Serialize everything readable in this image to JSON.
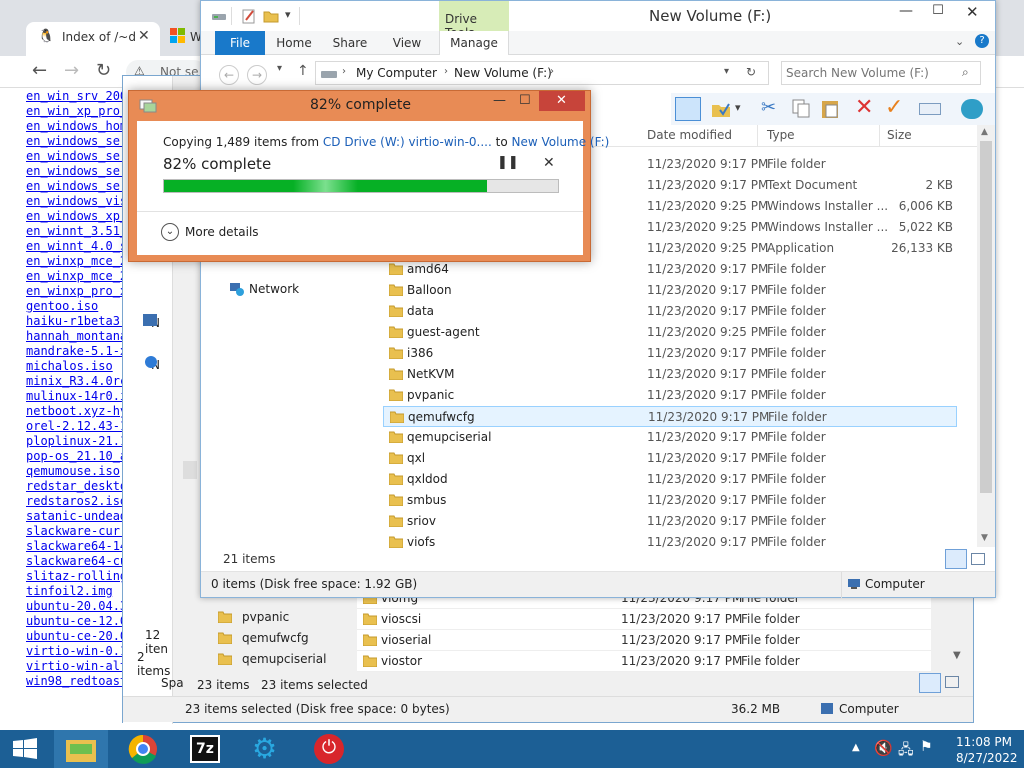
{
  "browser": {
    "tab1_title": "Index of /~d",
    "tab2_title": "W",
    "address_text": "Not se",
    "files": [
      "en_win_srv_200",
      "en_win_xp_pro_",
      "en_windows_hom",
      "en_windows_ser",
      "en_windows_ser",
      "en_windows_ser",
      "en_windows_ser",
      "en_windows_vis",
      "en_windows_xp_",
      "en_winnt_3.51_",
      "en_winnt_4.0_s",
      "en_winxp_mce_2",
      "en_winxp_mce_2",
      "en_winxp_pro_x",
      "gentoo.iso",
      "haiku-r1beta3-",
      "hannah_montana",
      "mandrake-5.1-x",
      "michalos.iso",
      "minix_R3.4.0rc",
      "mulinux-14r0.i",
      "netboot.xyz-hy",
      "orel-2.12.43-1",
      "ploplinux-21.1",
      "pop-os_21.10_a",
      "qemumouse.iso",
      "redstar_deskto",
      "redstaros2.iso",
      "satanic-undead",
      "slackware-curr",
      "slackware64-14",
      "slackware64-cu",
      "slitaz-rolling",
      "tinfoil2.img",
      "ubuntu-20.04.3",
      "ubuntu-ce-12.0",
      "ubuntu-ce-20.0",
      "virtio-win-0.1",
      "virtio-win-alt",
      "win98_redtoast_al"
    ]
  },
  "explorer_back": {
    "nav_items": [
      "pvpanic",
      "qemufwcfg",
      "qemupciserial"
    ],
    "left_fragments": {
      "items_12": "12 iten",
      "items_2": "2 items",
      "spa": "Spa",
      "n1": "N",
      "n2": "N"
    },
    "rows": [
      {
        "name": "viomg",
        "date": "11/23/2020 9:17 PM",
        "type": "File folder"
      },
      {
        "name": "vioscsi",
        "date": "11/23/2020 9:17 PM",
        "type": "File folder"
      },
      {
        "name": "vioserial",
        "date": "11/23/2020 9:17 PM",
        "type": "File folder"
      },
      {
        "name": "viostor",
        "date": "11/23/2020 9:17 PM",
        "type": "File folder"
      }
    ],
    "status": {
      "items": "23 items",
      "selected": "23 items selected"
    },
    "bottom": {
      "left": "23 items selected (Disk free space: 0 bytes)",
      "size": "36.2 MB",
      "location": "Computer"
    }
  },
  "explorer": {
    "title": "New Volume (F:)",
    "context_tab": "Drive Tools",
    "tabs": {
      "file": "File",
      "home": "Home",
      "share": "Share",
      "view": "View",
      "manage": "Manage"
    },
    "breadcrumb": {
      "root": "My Computer",
      "current": "New Volume (F:)"
    },
    "search_placeholder": "Search New Volume (F:)",
    "columns": {
      "date": "Date modified",
      "type": "Type",
      "size": "Size"
    },
    "nav_network": "Network",
    "rows": [
      {
        "name": "",
        "date": "11/23/2020 9:17 PM",
        "type": "File folder",
        "size": ""
      },
      {
        "name": "",
        "date": "11/23/2020 9:17 PM",
        "type": "Text Document",
        "size": "2 KB"
      },
      {
        "name": "",
        "date": "11/23/2020 9:25 PM",
        "type": "Windows Installer ...",
        "size": "6,006 KB"
      },
      {
        "name": "",
        "date": "11/23/2020 9:25 PM",
        "type": "Windows Installer ...",
        "size": "5,022 KB"
      },
      {
        "name": "",
        "date": "11/23/2020 9:25 PM",
        "type": "Application",
        "size": "26,133 KB"
      },
      {
        "name": "amd64",
        "date": "11/23/2020 9:17 PM",
        "type": "File folder",
        "size": ""
      },
      {
        "name": "Balloon",
        "date": "11/23/2020 9:17 PM",
        "type": "File folder",
        "size": ""
      },
      {
        "name": "data",
        "date": "11/23/2020 9:17 PM",
        "type": "File folder",
        "size": ""
      },
      {
        "name": "guest-agent",
        "date": "11/23/2020 9:25 PM",
        "type": "File folder",
        "size": ""
      },
      {
        "name": "i386",
        "date": "11/23/2020 9:17 PM",
        "type": "File folder",
        "size": ""
      },
      {
        "name": "NetKVM",
        "date": "11/23/2020 9:17 PM",
        "type": "File folder",
        "size": ""
      },
      {
        "name": "pvpanic",
        "date": "11/23/2020 9:17 PM",
        "type": "File folder",
        "size": ""
      },
      {
        "name": "qemufwcfg",
        "date": "11/23/2020 9:17 PM",
        "type": "File folder",
        "size": ""
      },
      {
        "name": "qemupciserial",
        "date": "11/23/2020 9:17 PM",
        "type": "File folder",
        "size": ""
      },
      {
        "name": "qxl",
        "date": "11/23/2020 9:17 PM",
        "type": "File folder",
        "size": ""
      },
      {
        "name": "qxldod",
        "date": "11/23/2020 9:17 PM",
        "type": "File folder",
        "size": ""
      },
      {
        "name": "smbus",
        "date": "11/23/2020 9:17 PM",
        "type": "File folder",
        "size": ""
      },
      {
        "name": "sriov",
        "date": "11/23/2020 9:17 PM",
        "type": "File folder",
        "size": ""
      },
      {
        "name": "viofs",
        "date": "11/23/2020 9:17 PM",
        "type": "File folder",
        "size": ""
      }
    ],
    "selected_index": 12,
    "item_count": "21 items",
    "status_left": "0 items (Disk free space: 1.92 GB)",
    "status_right": "Computer"
  },
  "copy_dialog": {
    "title": "82% complete",
    "line_prefix": "Copying 1,489 items from ",
    "source": "CD Drive (W:) virtio-win-0....",
    "line_mid": " to ",
    "dest": "New Volume (F:)",
    "progress_label": "82% complete",
    "progress_fraction": 0.82,
    "more_details": "More details"
  },
  "taskbar": {
    "time": "11:08 PM",
    "date": "8/27/2022"
  },
  "colors": {
    "accent": "#1979ca",
    "dialog_frame": "#e88b55",
    "progress": "#06b025",
    "taskbar": "#1c5f95",
    "close_red": "#c7443a"
  }
}
